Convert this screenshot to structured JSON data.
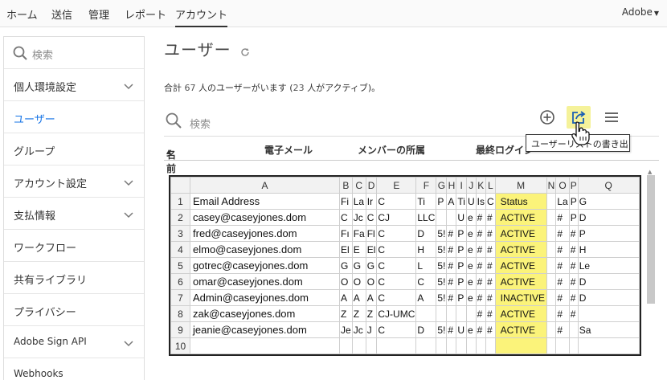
{
  "topnav": {
    "items": [
      "ホーム",
      "送信",
      "管理",
      "レポート",
      "アカウント"
    ],
    "brand": "Adobe"
  },
  "sidebar": {
    "search_placeholder": "検索",
    "items": [
      {
        "label": "個人環境設定"
      },
      {
        "label": "ユーザー"
      },
      {
        "label": "グループ"
      },
      {
        "label": "アカウント設定"
      },
      {
        "label": "支払情報"
      },
      {
        "label": "ワークフロー"
      },
      {
        "label": "共有ライブラリ"
      },
      {
        "label": "プライバシー"
      },
      {
        "label": "Adobe Sign API"
      },
      {
        "label": "Webhooks"
      }
    ]
  },
  "main": {
    "title": "ユーザー",
    "summary_prefix": "合計 ",
    "total": "67",
    "summary_mid": " 人のユーザーがいます (",
    "active": "23",
    "summary_suffix": " 人がアクティブ)。",
    "search_placeholder": "検索",
    "columns": [
      "名前",
      "電子メール",
      "メンバーの所属",
      "最終ログイン"
    ],
    "tooltip": "ユーザーリストの書き出し"
  },
  "spreadsheet": {
    "col_headers": [
      "",
      "A",
      "B",
      "C",
      "D",
      "E",
      "F",
      "G",
      "H",
      "I",
      "J",
      "K",
      "L",
      "M",
      "N",
      "O",
      "P",
      "Q"
    ],
    "rows": [
      [
        "1",
        "Email Address",
        "Fi",
        "La",
        "Ir",
        "C",
        "Ti",
        "P",
        "A",
        "Ti",
        "U",
        "Is",
        "C",
        "Status",
        "",
        "La",
        "P",
        "G"
      ],
      [
        "2",
        "casey@caseyjones.dom",
        "C",
        "Jc",
        "C",
        "CJ",
        "LLC",
        "",
        "",
        "U",
        "e",
        "#",
        "#",
        "ACTIVE",
        "",
        "#",
        "P",
        "D"
      ],
      [
        "3",
        "fred@caseyjones.dom",
        "Fı",
        "Fa",
        "Fl",
        "C",
        "D",
        "5!",
        "#",
        "P",
        "e",
        "#",
        "#",
        "ACTIVE",
        "",
        "#",
        "#",
        "P"
      ],
      [
        "4",
        "elmo@caseyjones.dom",
        "El",
        "E",
        "El",
        "C",
        "H",
        "5!",
        "#",
        "P",
        "e",
        "#",
        "#",
        "ACTIVE",
        "",
        "#",
        "#",
        "H"
      ],
      [
        "5",
        "gotrec@caseyjones.dom",
        "G",
        "G",
        "G",
        "C",
        "L",
        "5!",
        "#",
        "P",
        "e",
        "#",
        "#",
        "ACTIVE",
        "",
        "#",
        "#",
        "Le"
      ],
      [
        "6",
        "omar@caseyjones.dom",
        "O",
        "O",
        "O",
        "C",
        "C",
        "5!",
        "#",
        "P",
        "e",
        "#",
        "#",
        "ACTIVE",
        "",
        "#",
        "#",
        "D"
      ],
      [
        "7",
        "Admin@caseyjones.dom",
        "A",
        "A",
        "A",
        "C",
        "A",
        "5!",
        "#",
        "P",
        "e",
        "#",
        "#",
        "INACTIVE",
        "",
        "#",
        "#",
        "D"
      ],
      [
        "8",
        "zak@caseyjones.dom",
        "Z",
        "Z",
        "Z",
        "CJ-UMC",
        "",
        "",
        "",
        "",
        "",
        "#",
        "#",
        "ACTIVE",
        "",
        "#",
        "#",
        ""
      ],
      [
        "9",
        "jeanie@caseyjones.dom",
        "Je",
        "Jc",
        "J",
        "C",
        "D",
        "5!",
        "#",
        "U",
        "e",
        "#",
        "#",
        "ACTIVE",
        "",
        "#",
        "",
        "Sa"
      ],
      [
        "10",
        "",
        "",
        "",
        "",
        "",
        "",
        "",
        "",
        "",
        "",
        "",
        "",
        "",
        "",
        "",
        "",
        ""
      ]
    ]
  }
}
